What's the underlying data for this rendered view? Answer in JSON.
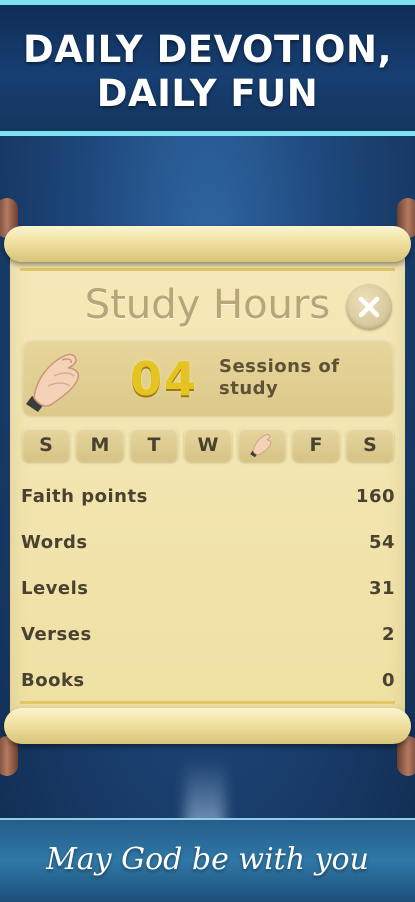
{
  "banner": {
    "line1": "DAILY DEVOTION,",
    "line2": "DAILY FUN"
  },
  "dialog": {
    "title": "Study Hours",
    "close_icon": "close-x-icon",
    "sessions": {
      "count": "04",
      "label_line1": "Sessions of",
      "label_line2": "study",
      "icon": "praying-hands-icon"
    },
    "days": [
      {
        "label": "S",
        "completed": false
      },
      {
        "label": "M",
        "completed": false
      },
      {
        "label": "T",
        "completed": false
      },
      {
        "label": "W",
        "completed": false
      },
      {
        "label": "",
        "completed": true,
        "icon": "praying-hands-icon"
      },
      {
        "label": "F",
        "completed": false
      },
      {
        "label": "S",
        "completed": false
      }
    ],
    "stats": [
      {
        "label": "Faith points",
        "value": "160"
      },
      {
        "label": "Words",
        "value": "54"
      },
      {
        "label": "Levels",
        "value": "31"
      },
      {
        "label": "Verses",
        "value": "2"
      },
      {
        "label": "Books",
        "value": "0"
      }
    ]
  },
  "footer": {
    "text": "May God be with you"
  },
  "colors": {
    "accent_gold": "#e5c320",
    "parchment": "#f5e9b9",
    "banner_border": "#7ee3f0"
  }
}
